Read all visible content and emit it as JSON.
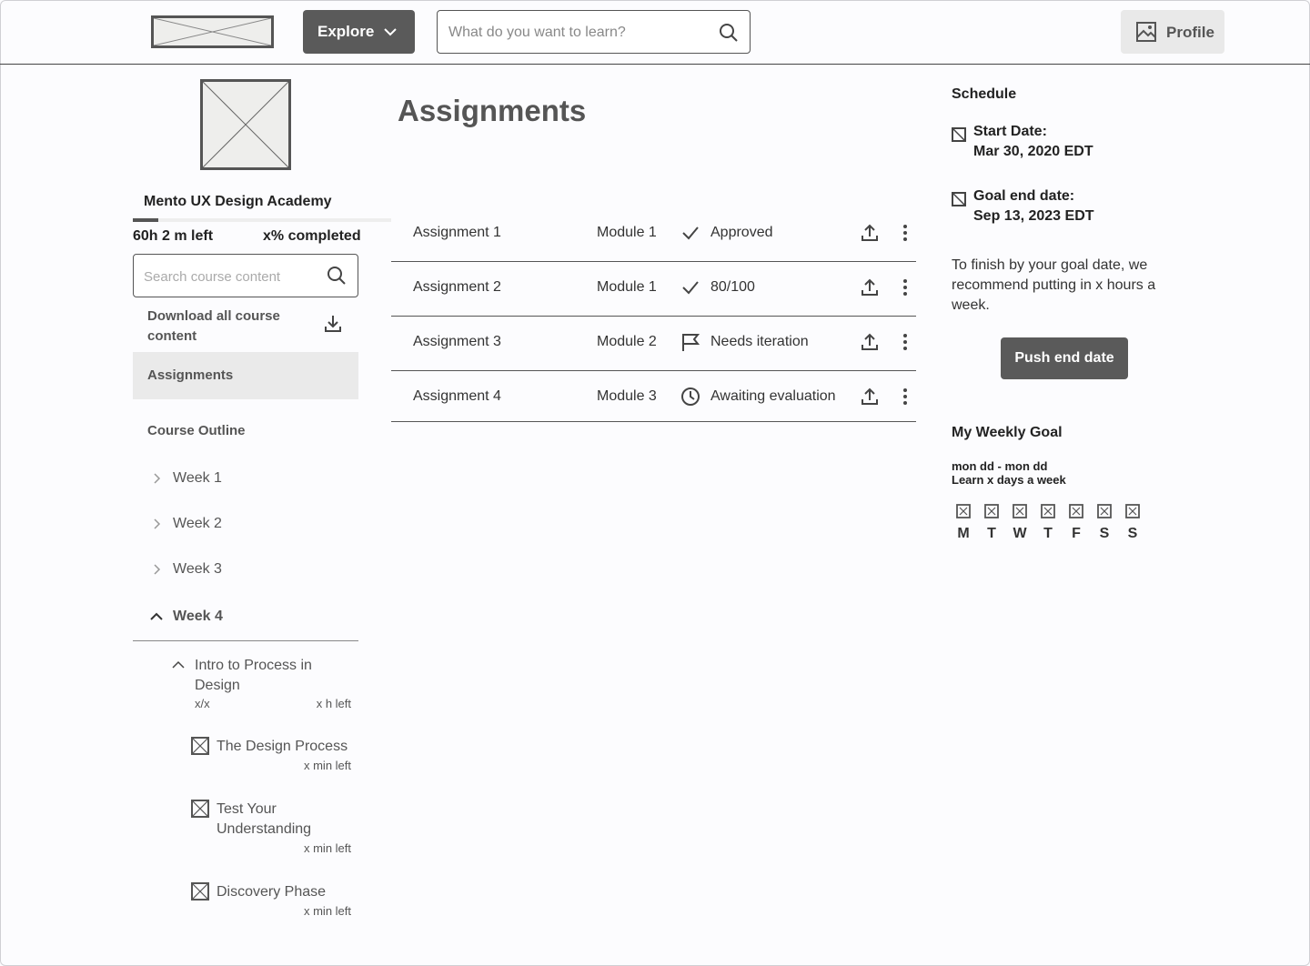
{
  "header": {
    "explore_label": "Explore",
    "search_placeholder": "What do you want to learn?",
    "profile_label": "Profile"
  },
  "sidebar": {
    "course_title": "Mento UX Design Academy",
    "time_left": "60h 2 m left",
    "completed": "x% completed",
    "progress": 0.1,
    "search_placeholder": "Search course content",
    "download_label": "Download all course content",
    "assignments_label": "Assignments",
    "outline_label": "Course Outline",
    "weeks": [
      {
        "label": "Week 1",
        "open": false
      },
      {
        "label": "Week 2",
        "open": false
      },
      {
        "label": "Week 3",
        "open": false
      },
      {
        "label": "Week 4",
        "open": true
      }
    ],
    "lesson": {
      "title": "Intro to Process in Design",
      "progress": "x/x",
      "time": "x h left"
    },
    "sub_items": [
      {
        "title": "The Design Process",
        "time": "x min left"
      },
      {
        "title": "Test Your Understanding",
        "time": "x min left"
      },
      {
        "title": "Discovery Phase",
        "time": "x min left"
      }
    ]
  },
  "main": {
    "title": "Assignments",
    "assignments": [
      {
        "name": "Assignment 1",
        "module": "Module 1",
        "status": "Approved",
        "status_icon": "check-icon"
      },
      {
        "name": "Assignment 2",
        "module": "Module 1",
        "status": "80/100",
        "status_icon": "check-icon"
      },
      {
        "name": "Assignment 3",
        "module": "Module 2",
        "status": "Needs iteration",
        "status_icon": "flag-icon"
      },
      {
        "name": "Assignment 4",
        "module": "Module 3",
        "status": "Awaiting evaluation",
        "status_icon": "clock-icon"
      }
    ]
  },
  "schedule": {
    "title": "Schedule",
    "start_label": "Start Date:",
    "start_value": "Mar 30, 2020 EDT",
    "goal_label": "Goal end date:",
    "goal_value": "Sep 13, 2023 EDT",
    "recommend_text": "To finish by your goal date, we recommend putting in x hours a week.",
    "push_label": "Push end date",
    "weekly_title": "My Weekly Goal",
    "weekly_range": "mon dd - mon dd",
    "weekly_learn": "Learn x days a week",
    "days": [
      "M",
      "T",
      "W",
      "T",
      "F",
      "S",
      "S"
    ]
  }
}
